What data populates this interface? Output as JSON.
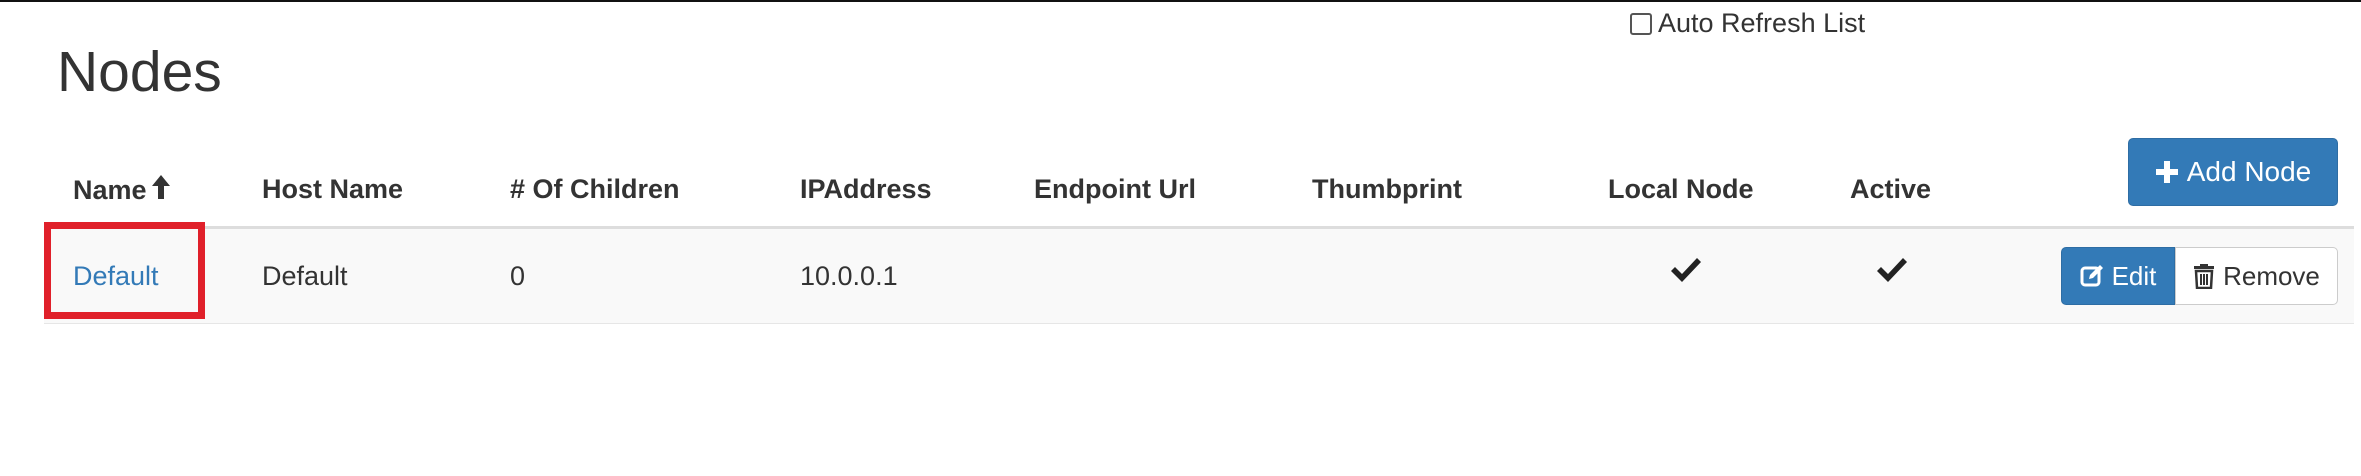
{
  "page": {
    "title": "Nodes",
    "auto_refresh_label": "Auto Refresh List",
    "auto_refresh_checked": false
  },
  "table": {
    "columns": [
      "Name",
      "Host Name",
      "# Of Children",
      "IPAddress",
      "Endpoint Url",
      "Thumbprint",
      "Local Node",
      "Active"
    ],
    "sort_column": "Name",
    "sort_direction": "ascending",
    "add_button_label": "Add Node",
    "rows": [
      {
        "name": "Default",
        "host_name": "Default",
        "children": "0",
        "ip_address": "10.0.0.1",
        "endpoint_url": "",
        "thumbprint": "",
        "local_node": true,
        "active": true,
        "edit_label": "Edit",
        "remove_label": "Remove"
      }
    ]
  },
  "colors": {
    "primary": "#337ab7",
    "highlight": "#e0202a",
    "text": "#333333"
  },
  "icons": {
    "sort": "arrow-up-icon",
    "add": "plus-icon",
    "edit": "edit-icon",
    "remove": "trash-icon",
    "check": "checkmark-icon"
  }
}
